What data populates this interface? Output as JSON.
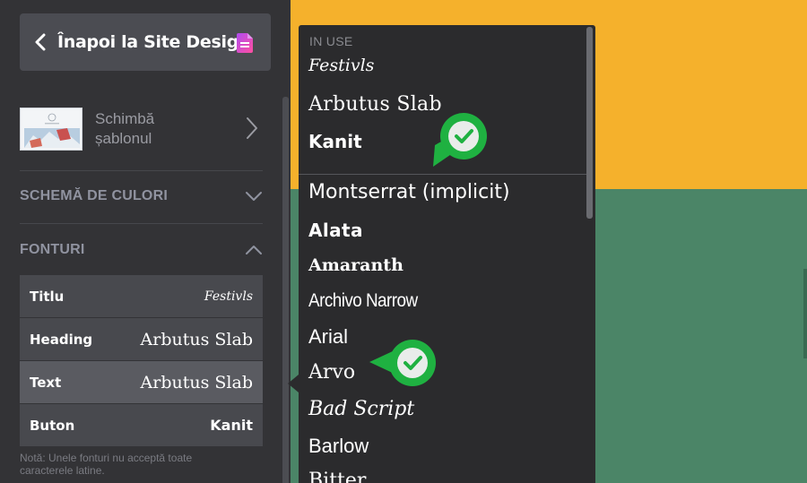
{
  "sidebar": {
    "back_label": "Înapoi la Site Design",
    "template_label": "Schimbă șablonul",
    "sections": {
      "colors": "SCHEMĂ DE CULORI",
      "fonts": "FONTURI"
    },
    "font_rows": [
      {
        "label": "Titlu",
        "value": "Festivls"
      },
      {
        "label": "Heading",
        "value": "Arbutus Slab"
      },
      {
        "label": "Text",
        "value": "Arbutus Slab"
      },
      {
        "label": "Buton",
        "value": "Kanit"
      }
    ],
    "note": "Notă: Unele fonturi nu acceptă toate caracterele latine."
  },
  "dropdown": {
    "in_use_label": "IN USE",
    "in_use": [
      "Festivls",
      "Arbutus Slab",
      "Kanit"
    ],
    "fonts": [
      "Montserrat (implicit)",
      "Alata",
      "Amaranth",
      "Archivo Narrow",
      "Arial",
      "Arvo",
      "Bad Script",
      "Barlow",
      "Bitter"
    ]
  },
  "colors": {
    "accent_orange": "#f5b12c",
    "accent_green": "#4b8567",
    "marker_green": "#1fb141",
    "doc_icon_gradient": [
      "#b04cf0",
      "#ff4fa0"
    ]
  },
  "icons": [
    "chevron-left-icon",
    "document-icon",
    "chevron-right-icon",
    "chevron-down-icon",
    "chevron-up-icon",
    "check-marker-icon"
  ]
}
